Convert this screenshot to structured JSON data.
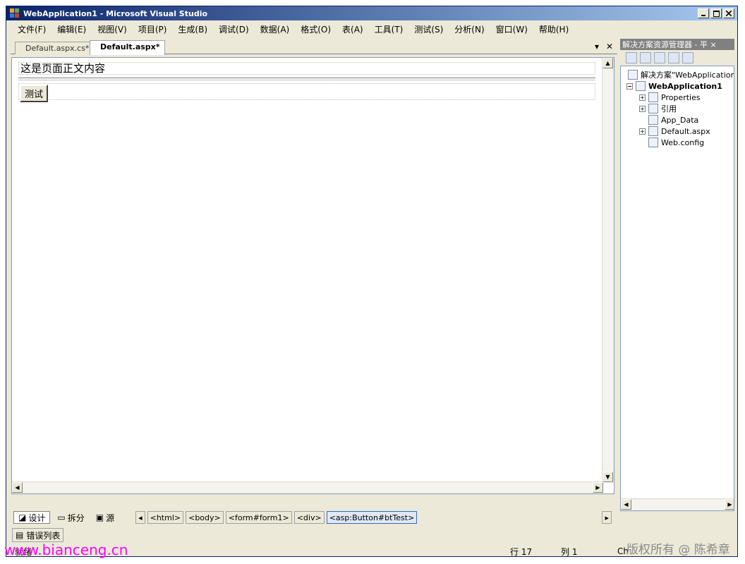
{
  "window": {
    "title": "WebApplication1 - Microsoft Visual Studio"
  },
  "menu": [
    "文件(F)",
    "编辑(E)",
    "视图(V)",
    "项目(P)",
    "生成(B)",
    "调试(D)",
    "数据(A)",
    "格式(O)",
    "表(A)",
    "工具(T)",
    "测试(S)",
    "分析(N)",
    "窗口(W)",
    "帮助(H)"
  ],
  "tabs": [
    {
      "label": "Default.aspx.cs*",
      "active": false
    },
    {
      "label": "Default.aspx*",
      "active": true
    }
  ],
  "designer": {
    "page_text": "这是页面正文内容",
    "button_label": "测试"
  },
  "view_buttons": [
    {
      "label": "设计",
      "active": true
    },
    {
      "label": "拆分",
      "active": false
    },
    {
      "label": "源",
      "active": false
    }
  ],
  "tag_path": [
    "<html>",
    "<body>",
    "<form#form1>",
    "<div>",
    "<asp:Button#btTest>"
  ],
  "solution_explorer": {
    "title": "解决方案资源管理器 - 平 ×",
    "tree": [
      {
        "label": "解决方案\"WebApplication1",
        "level": 0,
        "bold": false
      },
      {
        "label": "WebApplication1",
        "level": 1,
        "bold": true,
        "expander": "-"
      },
      {
        "label": "Properties",
        "level": 2,
        "bold": false,
        "expander": "+"
      },
      {
        "label": "引用",
        "level": 2,
        "bold": false,
        "expander": "+"
      },
      {
        "label": "App_Data",
        "level": 2,
        "bold": false
      },
      {
        "label": "Default.aspx",
        "level": 2,
        "bold": false,
        "expander": "+"
      },
      {
        "label": "Web.config",
        "level": 2,
        "bold": false
      }
    ]
  },
  "error_list_tab": "错误列表",
  "status": {
    "ready": "就绪",
    "row": "行 17",
    "col": "列 1",
    "ch": "Ch"
  },
  "watermarks": {
    "left": "www.bianceng.cn",
    "right": "版权所有 @ 陈希章"
  }
}
